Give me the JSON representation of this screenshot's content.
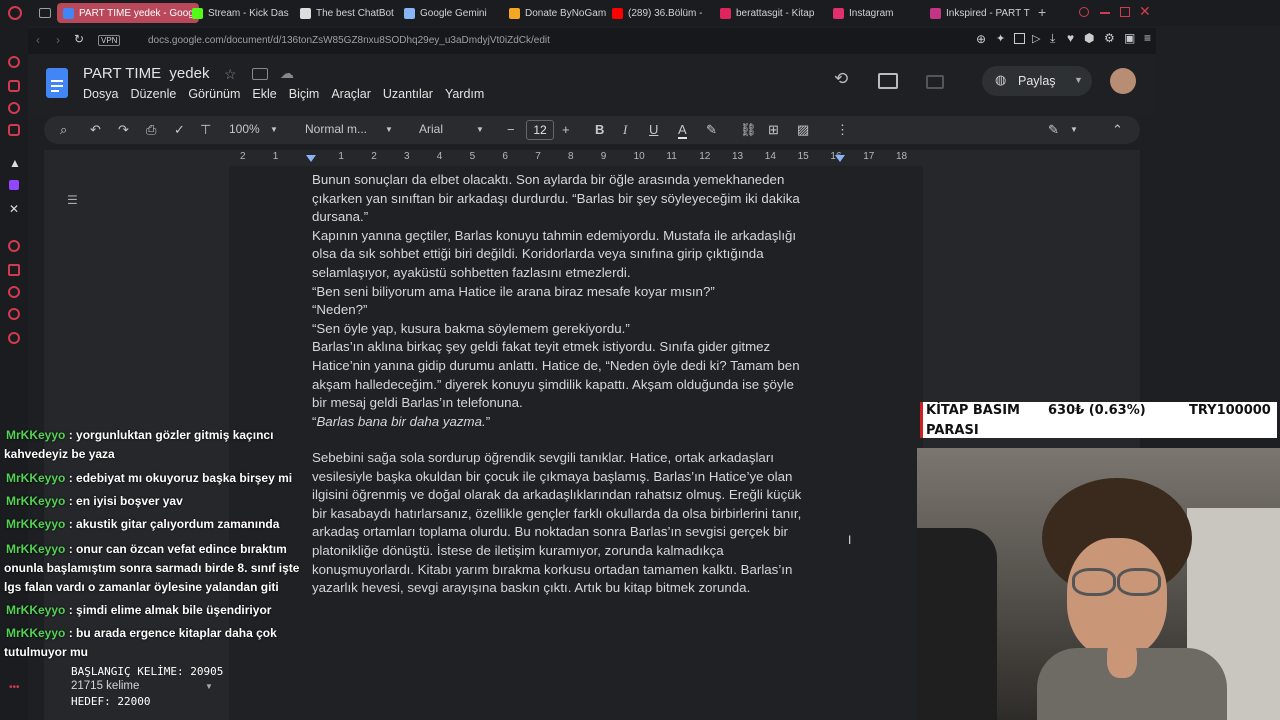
{
  "browser": {
    "tabs": [
      {
        "label": "PART TIME yedek - Goog",
        "active": true,
        "icon_color": "#4285f4"
      },
      {
        "label": "Stream - Kick Das",
        "icon_color": "#53fc18"
      },
      {
        "label": "The best ChatBot",
        "icon_color": "#dddddd"
      },
      {
        "label": "Google Gemini",
        "icon_color": "#8ab4f8"
      },
      {
        "label": "Donate ByNoGam",
        "icon_color": "#f5a623"
      },
      {
        "label": "(289) 36.Bölüm -",
        "icon_color": "#ff0000"
      },
      {
        "label": "berattasgit - Kitap",
        "icon_color": "#e0245e"
      },
      {
        "label": "Instagram",
        "icon_color": "#e1306c"
      },
      {
        "label": "Inkspired - PART T",
        "icon_color": "#c13584"
      }
    ],
    "new_tab": "+",
    "vpn_label": "VPN",
    "url": "docs.google.com/document/d/136tonZsW85GZ8nxu8SODhq29ey_u3aDmdyjVt0iZdCk/edit"
  },
  "docs": {
    "title": "PART TIME  yedek",
    "menu": [
      "Dosya",
      "Düzenle",
      "Görünüm",
      "Ekle",
      "Biçim",
      "Araçlar",
      "Uzantılar",
      "Yardım"
    ],
    "share_label": "Paylaş",
    "toolbar": {
      "zoom": "100%",
      "style": "Normal m...",
      "font": "Arial",
      "font_size": "12"
    },
    "ruler_numbers": [
      "2",
      "1",
      "",
      "1",
      "2",
      "3",
      "4",
      "5",
      "6",
      "7",
      "8",
      "9",
      "10",
      "11",
      "12",
      "13",
      "14",
      "15",
      "16",
      "17",
      "18"
    ],
    "paragraphs": [
      {
        "text": "Bunun sonuçları da elbet olacaktı. Son aylarda bir öğle arasında yemekhaneden\nçıkarken yan sınıftan bir arkadaşı durdurdu. “Barlas bir şey söyleyeceğim iki dakika\ndursana.”\nKapının yanına geçtiler, Barlas konuyu tahmin edemiyordu. Mustafa ile arkadaşlığı\nolsa da sık sohbet ettiği biri değildi. Koridorlarda veya sınıfına girip çıktığında\nselamlaşıyor, ayaküstü sohbetten fazlasını etmezlerdi.\n“Ben seni biliyorum ama Hatice ile arana biraz mesafe koyar mısın?”\n“Neden?”\n“Sen öyle yap, kusura bakma söylemem gerekiyordu.”\nBarlas’ın aklına birkaç şey geldi fakat teyit etmek istiyordu. Sınıfa gider gitmez\nHatice’nin yanına gidip durumu anlattı. Hatice de, “Neden öyle dedi ki? Tamam ben\nakşam halledeceğim.” diyerek konuyu şimdilik kapattı. Akşam olduğunda ise şöyle\nbir mesaj geldi Barlas’ın telefonuna."
      },
      {
        "text_pre": "“",
        "text_italic": "Barlas bana bir daha yazma.",
        "text_post": "”"
      },
      {
        "text": "Sebebini sağa sola sordurup öğrendik sevgili tanıklar. Hatice, ortak arkadaşları\nvesilesiyle başka okuldan bir çocuk ile çıkmaya başlamış. Barlas’ın Hatice’ye olan\nilgisini öğrenmiş ve doğal olarak da arkadaşlıklarından rahatsız olmuş. Ereğli küçük\nbir kasabaydı hatırlarsanız, özellikle gençler farklı okullarda da olsa birbirlerini tanır,\narkadaş ortamları toplama olurdu. Bu noktadan sonra Barlas’ın sevgisi gerçek bir\nplatonikliğe dönüştü. İstese de iletişim kuramıyor, zorunda kalmadıkça\nkonuşmuyorlardı. Kitabı yarım bırakma korkusu ortadan tamamen kalktı. Barlas’ın\nyazarlık hevesi, sevgi arayışına baskın çıktı. Artık bu kitap bitmek zorunda."
      }
    ]
  },
  "chat": [
    {
      "user": "MrKKeyyo",
      "message": ": yorgunluktan gözler gitmiş kaçıncı kahvedeyiz be yaza"
    },
    {
      "user": "MrKKeyyo",
      "message": ": edebiyat mı okuyoruz başka birşey mi"
    },
    {
      "user": "MrKKeyyo",
      "message": ": en iyisi boşver yav"
    },
    {
      "user": "MrKKeyyo",
      "message": ": akustik gitar çalıyordum zamanında"
    },
    {
      "user": "MrKKeyyo",
      "message": ": onur can özcan vefat edince bıraktım onunla başlamıştım sonra sarmadı birde 8. sınıf işte lgs falan vardı o zamanlar öylesine yalandan giti"
    },
    {
      "user": "MrKKeyyo",
      "message": ": şimdi elime almak bile üşendiriyor"
    },
    {
      "user": "MrKKeyyo",
      "message": ": bu arada ergence kitaplar daha çok tutulmuyor mu"
    }
  ],
  "counters": {
    "start": "BAŞLANGIÇ KELİME: 20905",
    "words": "21715 kelime",
    "target": "HEDEF: 22000"
  },
  "ticker": {
    "label_line1": "KİTAP BASIM",
    "label_line2": "PARASI",
    "amount": "630₺ (0.63%)",
    "goal": "TRY100000"
  }
}
